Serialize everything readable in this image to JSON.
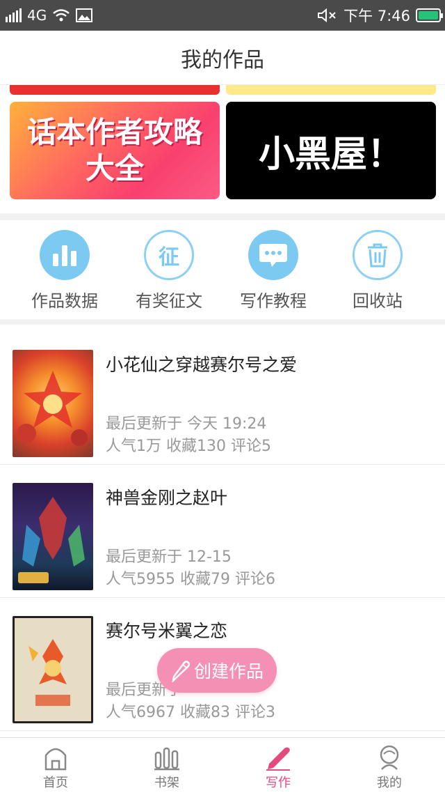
{
  "status_bar": {
    "network": "4G",
    "time": "下午 7:46",
    "battery_color": "#27c27a"
  },
  "header": {
    "title": "我的作品"
  },
  "banners": [
    {
      "text_line1": "话本作者攻略",
      "text_line2": "大全",
      "icon": "guide-banner-image"
    },
    {
      "text": "小黑屋！",
      "icon": "blackroom-banner-image"
    }
  ],
  "quick_menu": [
    {
      "label": "作品数据",
      "icon": "bar-chart-icon"
    },
    {
      "label": "有奖征文",
      "icon": "contest-icon",
      "glyph": "征"
    },
    {
      "label": "写作教程",
      "icon": "chat-bubble-icon"
    },
    {
      "label": "回收站",
      "icon": "trash-icon"
    }
  ],
  "works": [
    {
      "title": "小花仙之穿越赛尔号之爱",
      "updated": "最后更新于 今天 19:24",
      "stats": "人气1万  收藏130  评论5"
    },
    {
      "title": "神兽金刚之赵叶",
      "updated": "最后更新于 12-15",
      "stats": "人气5955  收藏79  评论6"
    },
    {
      "title": "赛尔号米翼之恋",
      "updated": "最后更新于",
      "stats": "人气6967  收藏83  评论3"
    }
  ],
  "create_button": {
    "label": "创建作品"
  },
  "tabs": [
    {
      "label": "首页",
      "icon": "home-icon"
    },
    {
      "label": "书架",
      "icon": "bookshelf-icon"
    },
    {
      "label": "写作",
      "icon": "pencil-icon",
      "active": true
    },
    {
      "label": "我的",
      "icon": "profile-icon"
    }
  ],
  "colors": {
    "accent": "#e44b7c",
    "icon_blue": "#7cc9f2",
    "create_button": "#f590b5"
  }
}
